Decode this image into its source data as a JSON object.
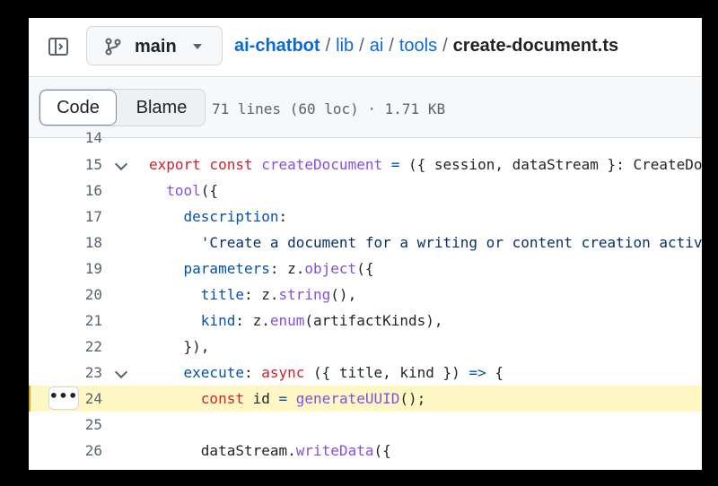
{
  "header": {
    "branch": "main",
    "breadcrumb": {
      "repo": "ai-chatbot",
      "dir1": "lib",
      "dir2": "ai",
      "dir3": "tools",
      "separator": "/",
      "file": "create-document.ts"
    }
  },
  "toolbar": {
    "code_label": "Code",
    "blame_label": "Blame",
    "file_info": "71 lines (60 loc) · 1.71 KB"
  },
  "code": {
    "line14": "14",
    "line15": "15",
    "line16": "16",
    "line17": "17",
    "line18": "18",
    "line19": "19",
    "line20": "20",
    "line21": "21",
    "line22": "22",
    "line23": "23",
    "line24": "24",
    "line25": "25",
    "line26": "26",
    "more_label": "•••",
    "t15a": "export",
    "t15b": " const ",
    "t15c": "createDocument",
    "t15d": " = ",
    "t15e": "({ session, dataStream }: CreateDo",
    "t16a": "  ",
    "t16b": "tool",
    "t16c": "({",
    "t17a": "    ",
    "t17b": "description",
    "t17c": ":",
    "t18a": "      ",
    "t18b": "'Create a document for a writing or content creation activ",
    "t19a": "    ",
    "t19b": "parameters",
    "t19c": ": z.",
    "t19d": "object",
    "t19e": "({",
    "t20a": "      ",
    "t20b": "title",
    "t20c": ": z.",
    "t20d": "string",
    "t20e": "(),",
    "t21a": "      ",
    "t21b": "kind",
    "t21c": ": z.",
    "t21d": "enum",
    "t21e": "(artifactKinds),",
    "t22a": "    }),",
    "t23a": "    ",
    "t23b": "execute",
    "t23c": ": ",
    "t23d": "async",
    "t23e": " ({ title, kind }) ",
    "t23f": "=>",
    "t23g": " {",
    "t24a": "      ",
    "t24b": "const",
    "t24c": " id ",
    "t24d": "=",
    "t24e": " ",
    "t24f": "generateUUID",
    "t24g": "();",
    "t26a": "      dataStream.",
    "t26b": "writeData",
    "t26c": "({"
  }
}
